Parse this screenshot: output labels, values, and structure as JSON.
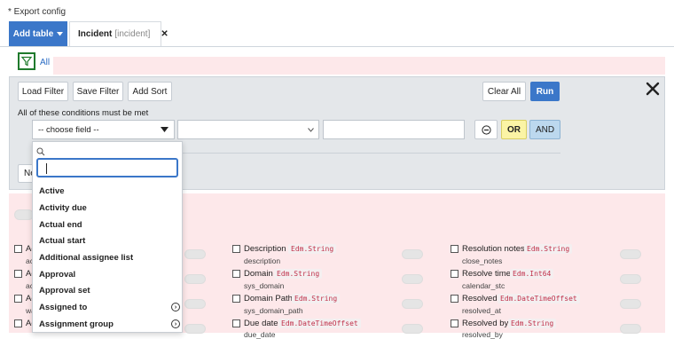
{
  "header": {
    "export_title": "* Export config"
  },
  "tabs": {
    "add_table_label": "Add table",
    "incident_name": "Incident",
    "incident_sys": "[incident]"
  },
  "filter": {
    "all_label": "All",
    "load_filter": "Load Filter",
    "save_filter": "Save Filter",
    "add_sort": "Add Sort",
    "clear_all": "Clear All",
    "run": "Run",
    "conditions_label": "All of these conditions must be met",
    "choose_field": "-- choose field --",
    "or_label": "OR",
    "and_label": "AND",
    "new_peek": "Ne"
  },
  "dropdown": {
    "search_value": "",
    "items": [
      {
        "label": "Active",
        "has_children": false
      },
      {
        "label": "Activity due",
        "has_children": false
      },
      {
        "label": "Actual end",
        "has_children": false
      },
      {
        "label": "Actual start",
        "has_children": false
      },
      {
        "label": "Additional assignee list",
        "has_children": false
      },
      {
        "label": "Approval",
        "has_children": false
      },
      {
        "label": "Approval set",
        "has_children": false
      },
      {
        "label": "Assigned to",
        "has_children": true
      },
      {
        "label": "Assignment group",
        "has_children": true
      }
    ]
  },
  "fields": {
    "left_stubs": [
      {
        "name": "Ac",
        "sub": "ac"
      },
      {
        "name": "Ac",
        "sub": "ac"
      },
      {
        "name": "Ac",
        "sub": "wa"
      },
      {
        "name": "Ac",
        "sub": ""
      }
    ],
    "middle": [
      {
        "name": "Description",
        "type": "Edm.String",
        "sub": "description"
      },
      {
        "name": "Domain",
        "type": "Edm.String",
        "sub": "sys_domain"
      },
      {
        "name": "Domain Path",
        "type": "Edm.String",
        "sub": "sys_domain_path"
      },
      {
        "name": "Due date",
        "type": "Edm.DateTimeOffset",
        "sub": "due_date"
      }
    ],
    "right": [
      {
        "name": "Resolution notes",
        "type": "Edm.String",
        "sub": "close_notes"
      },
      {
        "name": "Resolve time",
        "type": "Edm.Int64",
        "sub": "calendar_stc"
      },
      {
        "name": "Resolved",
        "type": "Edm.DateTimeOffset",
        "sub": "resolved_at"
      },
      {
        "name": "Resolved by",
        "type": "Edm.String",
        "sub": "resolved_by"
      }
    ]
  },
  "colors": {
    "accent": "#3b77c9",
    "or_bg": "#fbf4a5",
    "and_bg": "#bcd8ee",
    "pink_bg": "#fde8ea",
    "type_text": "#c0304a"
  }
}
